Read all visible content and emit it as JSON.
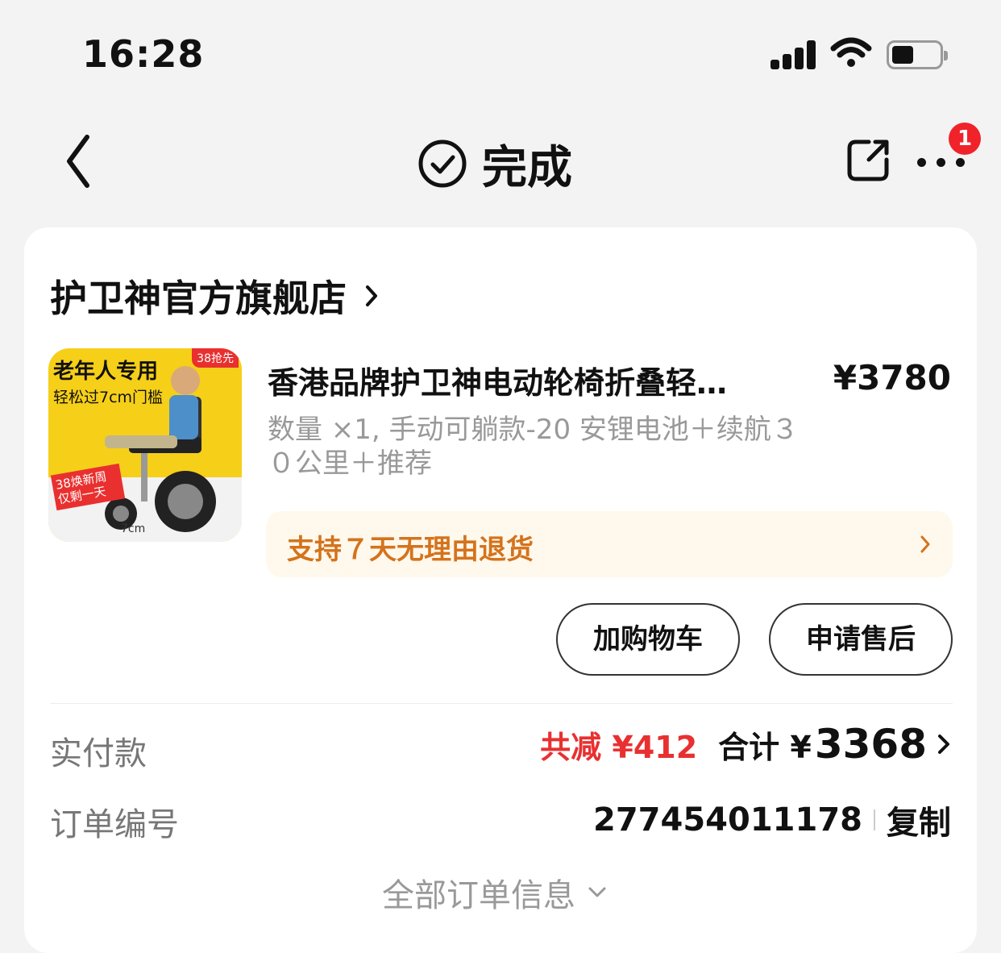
{
  "status_bar": {
    "time": "16:28"
  },
  "nav": {
    "title": "完成",
    "badge_count": "1"
  },
  "shop": {
    "name": "护卫神官方旗舰店"
  },
  "product": {
    "title": "香港品牌护卫神电动轮椅折叠轻…",
    "price": "¥3780",
    "spec": "数量 ×1, 手动可躺款-20 安锂电池＋续航３０公里＋推荐",
    "thumbnail_text": {
      "headline": "老年人专用",
      "subline": "轻松过7cm门槛",
      "corner_tag": "38抢先",
      "promo": "38焕新周 仅剩一天",
      "measure": "7cm"
    }
  },
  "return_policy": {
    "text": "支持７天无理由退货"
  },
  "buttons": {
    "add_cart": "加购物车",
    "after_sale": "申请售后"
  },
  "payment": {
    "label": "实付款",
    "discount": "共减 ¥412",
    "total_label": "合计 ¥",
    "total_value": "3368"
  },
  "order": {
    "label": "订单编号",
    "number": "277454011178",
    "copy": "复制"
  },
  "more_info": {
    "text": "全部订单信息"
  },
  "colors": {
    "discount_red": "#e93030",
    "return_orange": "#d4731c",
    "badge_red": "#f0232b"
  }
}
